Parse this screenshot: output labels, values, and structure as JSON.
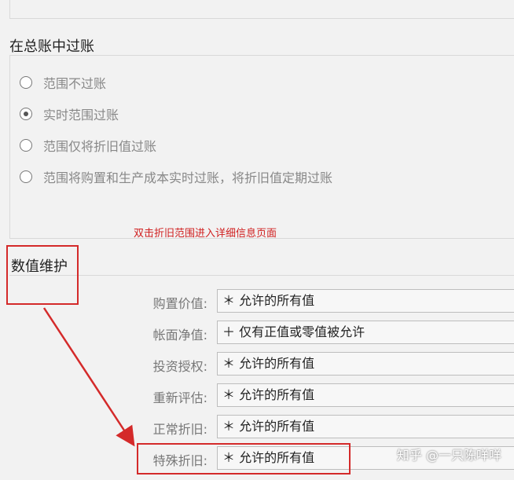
{
  "posting_section": {
    "title": "在总账中过账",
    "options": [
      {
        "label": "范围不过账",
        "checked": false
      },
      {
        "label": "实时范围过账",
        "checked": true
      },
      {
        "label": "范围仅将折旧值过账",
        "checked": false
      },
      {
        "label": "范围将购置和生产成本实时过账，将折旧值定期过账",
        "checked": false
      }
    ]
  },
  "annotation": "双击折旧范围进入详细信息页面",
  "value_maintenance": {
    "title": "数值维护",
    "fields": [
      {
        "label": "购置价值:",
        "value": "＊ 允许的所有值"
      },
      {
        "label": "帐面净值:",
        "value": "＋ 仅有正值或零值被允许"
      },
      {
        "label": "投资授权:",
        "value": "＊ 允许的所有值"
      },
      {
        "label": "重新评估:",
        "value": "＊ 允许的所有值"
      },
      {
        "label": "正常折旧:",
        "value": "＊ 允许的所有值"
      },
      {
        "label": "特殊折旧:",
        "value": "＊ 允许的所有值"
      }
    ]
  },
  "watermark": "知乎 @一只陈咩咩",
  "colors": {
    "highlight": "#d42a2a",
    "background": "#f2f2f2"
  }
}
